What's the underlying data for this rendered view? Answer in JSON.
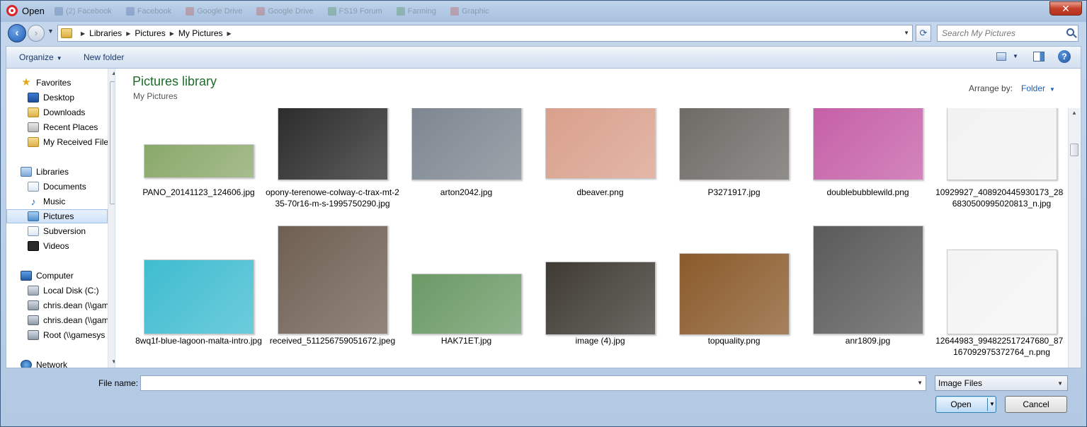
{
  "window": {
    "title": "Open"
  },
  "background_tabs": [
    "(2) Facebook",
    "Facebook",
    "Google Drive",
    "Google Drive",
    "FS19 Forum",
    "Farming",
    "Graphic"
  ],
  "address": {
    "crumbs": [
      "Libraries",
      "Pictures",
      "My Pictures"
    ],
    "search_placeholder": "Search My Pictures"
  },
  "toolbar": {
    "organize": "Organize",
    "new_folder": "New folder"
  },
  "sidebar": {
    "favorites": "Favorites",
    "favorites_items": [
      "Desktop",
      "Downloads",
      "Recent Places",
      "My Received Files"
    ],
    "libraries": "Libraries",
    "library_items": [
      "Documents",
      "Music",
      "Pictures",
      "Subversion",
      "Videos"
    ],
    "computer": "Computer",
    "computer_items": [
      "Local Disk (C:)",
      "chris.dean (\\\\gamesys",
      "chris.dean (\\\\gamesys",
      "Root (\\\\gamesys"
    ],
    "network": "Network",
    "selected": "Pictures"
  },
  "content": {
    "title": "Pictures library",
    "subtitle": "My Pictures",
    "arrange_label": "Arrange by:",
    "arrange_value": "Folder",
    "files": [
      {
        "name": "PANO_20141123_124606.jpg",
        "color": "#8aa86a"
      },
      {
        "name": "opony-terenowe-colway-c-trax-mt-235-70r16-m-s-1995750290.jpg",
        "color": "#2b2b2b"
      },
      {
        "name": "arton2042.jpg",
        "color": "#7d8690"
      },
      {
        "name": "dbeaver.png",
        "color": "#d9a08c"
      },
      {
        "name": "P3271917.jpg",
        "color": "#6d6a66"
      },
      {
        "name": "doublebubblewild.png",
        "color": "#c55fa7"
      },
      {
        "name": "10929927_408920445930173_2836830500995020813_n.jpg",
        "color": "#f2f2f2"
      },
      {
        "name": "8wq1f-blue-lagoon-malta-intro.jpg",
        "color": "#3fbcd0"
      },
      {
        "name": "received_511256759051672.jpeg",
        "color": "#6f5f52"
      },
      {
        "name": "HAK71ET.jpg",
        "color": "#6b9a66"
      },
      {
        "name": "image (4).jpg",
        "color": "#3e3a33"
      },
      {
        "name": "topquality.png",
        "color": "#8a5a2a"
      },
      {
        "name": "anr1809.jpg",
        "color": "#5a5a5a"
      },
      {
        "name": "12644983_994822517247680_878167092975372764_n.png",
        "color": "#f4f4f4"
      }
    ]
  },
  "footer": {
    "filename_label": "File name:",
    "filename_value": "",
    "filetype": "Image Files",
    "open": "Open",
    "cancel": "Cancel"
  }
}
